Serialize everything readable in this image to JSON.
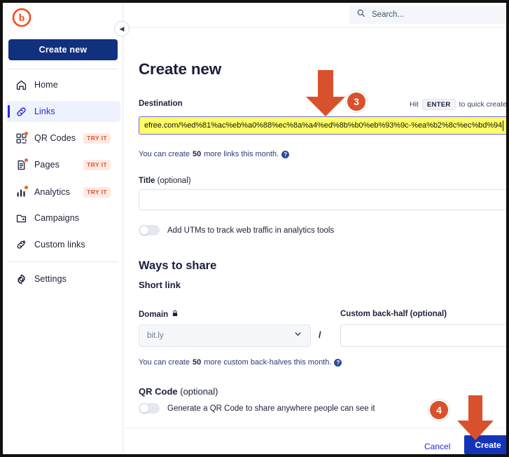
{
  "app": {
    "logo_name": "bitly-logo",
    "create_new_label": "Create new"
  },
  "topbar": {
    "search_placeholder": "Search...",
    "search_icon": "search-icon"
  },
  "sidebar": {
    "collapse_icon": "chevron-left-icon",
    "items": [
      {
        "label": "Home",
        "icon": "home-icon",
        "badge": "",
        "active": false,
        "dot": false
      },
      {
        "label": "Links",
        "icon": "link-icon",
        "badge": "",
        "active": true,
        "dot": false
      },
      {
        "label": "QR Codes",
        "icon": "qr-code-icon",
        "badge": "TRY IT",
        "active": false,
        "dot": true
      },
      {
        "label": "Pages",
        "icon": "page-icon",
        "badge": "TRY IT",
        "active": false,
        "dot": true
      },
      {
        "label": "Analytics",
        "icon": "analytics-icon",
        "badge": "TRY IT",
        "active": false,
        "dot": true
      },
      {
        "label": "Campaigns",
        "icon": "campaign-icon",
        "badge": "",
        "active": false,
        "dot": false
      },
      {
        "label": "Custom links",
        "icon": "custom-link-icon",
        "badge": "",
        "active": false,
        "dot": false
      },
      {
        "label": "Settings",
        "icon": "gear-icon",
        "badge": "",
        "active": false,
        "dot": false
      }
    ]
  },
  "main": {
    "page_title": "Create new",
    "destination": {
      "label": "Destination",
      "value": "efree.com/%ed%81%ac%eb%a0%88%ec%8a%a4%ed%8b%b0%eb%93%9c-%ea%b2%8c%ec%bd%94",
      "hint_prefix": "Hit",
      "hint_key": "ENTER",
      "hint_suffix": "to quick create",
      "helper_pre": "You can create",
      "helper_count": "50",
      "helper_post": "more links this month.",
      "help_icon": "question-mark-icon"
    },
    "title_field": {
      "label": "Title",
      "optional": " (optional)",
      "value": ""
    },
    "utm": {
      "toggle_state": "off",
      "label": "Add UTMs to track web traffic in analytics tools"
    },
    "ways_to_share": {
      "heading": "Ways to share",
      "short_link_heading": "Short link",
      "domain_label": "Domain",
      "domain_lock_icon": "lock-icon",
      "domain_value": "bit.ly",
      "domain_chevron": "chevron-down-icon",
      "separator": "/",
      "backhalf_label": "Custom back-half (optional)",
      "backhalf_value": "",
      "helper_pre": "You can create",
      "helper_count": "50",
      "helper_post": "more custom back-halves this month.",
      "help_icon": "question-mark-icon"
    },
    "qr_code": {
      "label": "QR Code",
      "optional": " (optional)",
      "toggle_state": "off",
      "description": "Generate a QR Code to share anywhere people can see it"
    },
    "footer": {
      "cancel_label": "Cancel",
      "create_label": "Create"
    }
  },
  "annotations": [
    {
      "name": "step-3",
      "number": "3"
    },
    {
      "name": "step-4",
      "number": "4"
    }
  ],
  "colors": {
    "brand_orange": "#ee6123",
    "brand_navy": "#11307e",
    "accent_blue": "#2828c8",
    "annotation_orange": "#d9512c",
    "highlight_yellow": "#ffff66"
  }
}
